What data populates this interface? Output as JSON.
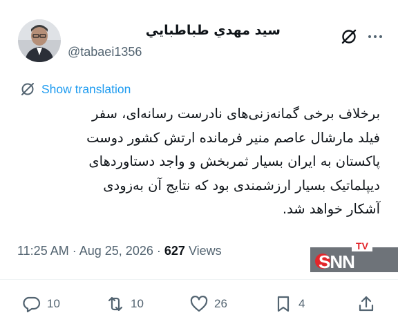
{
  "author": {
    "display_name": "سيد مهدي طباطبايي",
    "handle": "@tabaei1356"
  },
  "header_icons": [
    "grok-icon",
    "more-icon"
  ],
  "translation": {
    "label": "Show translation"
  },
  "tweet": {
    "lines": [
      "برخلاف برخی گمانه‌زنی‌های نادرست رسانه‌ای، سفر",
      "فیلد مارشال عاصم منیر فرمانده ارتش کشور دوست",
      "پاکستان به ایران بسیار ثمربخش و واجد دستاوردهای",
      "دیپلماتیک بسیار ارزشمندی بود که نتایج آن به‌زودی",
      "آشکار خواهد شد."
    ]
  },
  "meta": {
    "time": "11:25 AM",
    "separator": "·",
    "date": "Aug 25, 2026",
    "views_count": "627",
    "views_label": "Views"
  },
  "watermark": {
    "top": "TV",
    "main": "SNN"
  },
  "actions": {
    "replies": "10",
    "reposts": "10",
    "likes": "26",
    "bookmarks": "4"
  },
  "colors": {
    "link": "#1d9bf0",
    "secondary_text": "#536471",
    "primary_text": "#0f1419",
    "watermark_red": "#e3262b"
  }
}
